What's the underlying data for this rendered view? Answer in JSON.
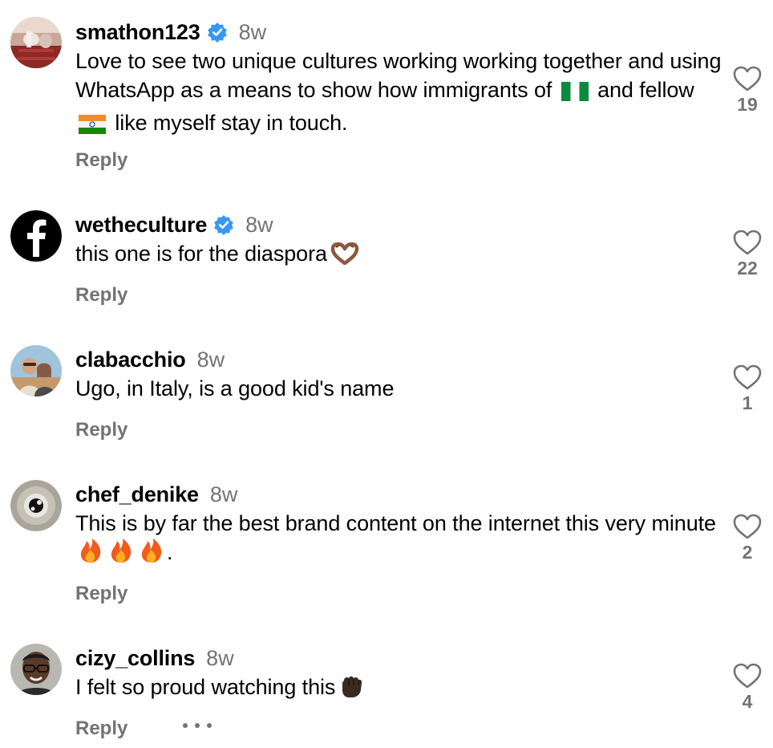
{
  "comments": [
    {
      "username": "smathon123",
      "verified": true,
      "time": "8w",
      "text_parts": [
        "Love to see two unique cultures working working together and using WhatsApp as a means to show how immigrants of",
        "and fellow",
        "like myself stay in touch."
      ],
      "reply_label": "Reply",
      "likes": "19"
    },
    {
      "username": "wetheculture",
      "verified": true,
      "time": "8w",
      "text": "this one is for the diaspora",
      "reply_label": "Reply",
      "likes": "22"
    },
    {
      "username": "clabacchio",
      "verified": false,
      "time": "8w",
      "text": "Ugo, in Italy, is a good kid's name",
      "reply_label": "Reply",
      "likes": "1"
    },
    {
      "username": "chef_denike",
      "verified": false,
      "time": "8w",
      "text_parts": [
        "This is by far the best brand content on the internet this very minute",
        "."
      ],
      "reply_label": "Reply",
      "likes": "2"
    },
    {
      "username": "cizy_collins",
      "verified": false,
      "time": "8w",
      "text": "I felt so proud watching this",
      "reply_label": "Reply",
      "likes": "4"
    }
  ],
  "icons": {
    "verified": "verified-badge-icon",
    "like": "heart-outline-icon",
    "more": "more-options-icon"
  },
  "colors": {
    "verified": "#3897f0",
    "secondary_text": "#737373",
    "primary_text": "#000000"
  }
}
